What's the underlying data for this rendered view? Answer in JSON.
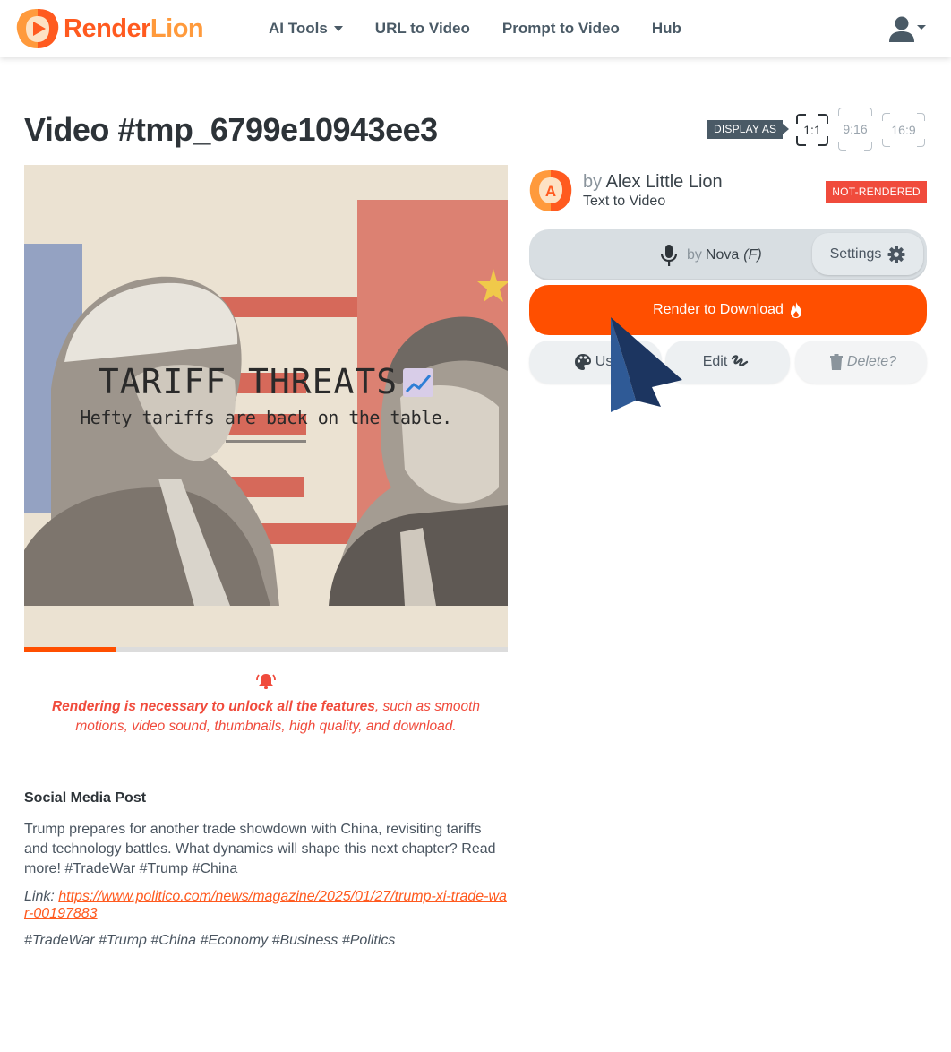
{
  "navbar": {
    "brand": {
      "part1": "Render",
      "part2": "Lion"
    },
    "links": [
      {
        "label": "AI Tools",
        "has_dropdown": true
      },
      {
        "label": "URL to Video",
        "has_dropdown": false
      },
      {
        "label": "Prompt to Video",
        "has_dropdown": false
      },
      {
        "label": "Hub",
        "has_dropdown": false
      }
    ],
    "user_icon": "user-icon"
  },
  "page": {
    "title": "Video #tmp_6799e10943ee3"
  },
  "display": {
    "label": "DISPLAY AS",
    "ratios": [
      {
        "label": "1:1",
        "active": true
      },
      {
        "label": "9:16",
        "active": false
      },
      {
        "label": "16:9",
        "active": false
      }
    ]
  },
  "video": {
    "title": "TARIFF THREATS",
    "title_emoji": "chart-increasing-icon",
    "subtitle": "Hefty tariffs are back on the table.",
    "progress_percent": 19,
    "colors": {
      "progress": "#ff4f00",
      "track": "#dcdcdc"
    }
  },
  "notice": {
    "icon": "bell-ringing-icon",
    "bold_text": "Rendering is necessary to unlock all the features",
    "rest_text": ", such as smooth motions, video sound, thumbnails, high quality, and download."
  },
  "social": {
    "heading": "Social Media Post",
    "body": "Trump prepares for another trade showdown with China, revisiting tariffs and technology battles. What dynamics will shape this next chapter? Read more! #TradeWar #Trump #China",
    "link_label": "Link:",
    "link_url": "https://www.politico.com/news/magazine/2025/01/27/trump-xi-trade-war-00197883",
    "tags": "#TradeWar #Trump #China #Economy #Business #Politics"
  },
  "author": {
    "avatar_letter": "A",
    "by": "by",
    "name": "Alex Little Lion",
    "type": "Text to Video",
    "status": "NOT-RENDERED"
  },
  "voice": {
    "icon": "microphone-icon",
    "by": "by",
    "name": "Nova",
    "gender": "(F)",
    "settings_label": "Settings"
  },
  "actions": {
    "render_label": "Render to Download",
    "use_label": "Use",
    "edit_label": "Edit",
    "delete_label": "Delete?"
  },
  "colors": {
    "brand_orange": "#ff4f00",
    "status_red": "#f04b3c",
    "text_dark": "#2d3338",
    "nav_text": "#4a5a66"
  }
}
